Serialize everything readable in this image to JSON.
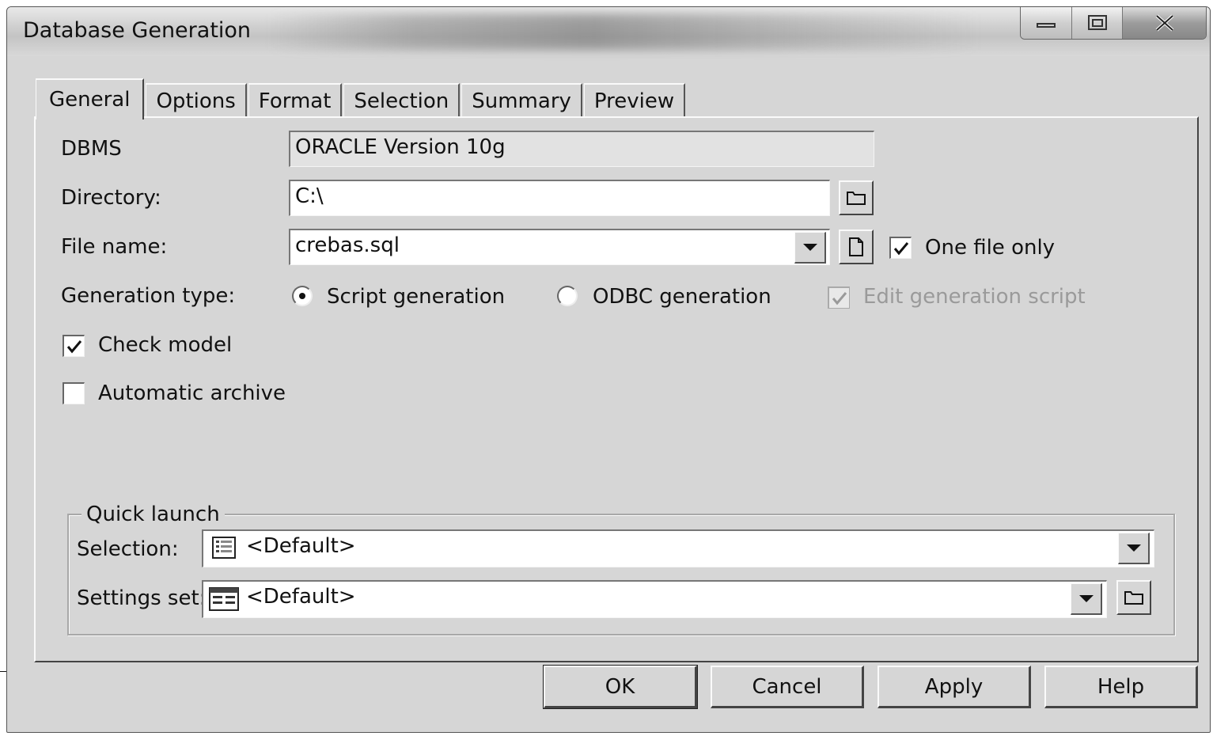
{
  "window": {
    "title": "Database Generation",
    "controls": {
      "minimize": "minimize",
      "maximize": "maximize",
      "close": "close"
    }
  },
  "tabs": [
    "General",
    "Options",
    "Format",
    "Selection",
    "Summary",
    "Preview"
  ],
  "active_tab": "General",
  "general": {
    "dbms_label": "DBMS",
    "dbms_value": "ORACLE Version 10g",
    "directory_label": "Directory:",
    "directory_value": "C:\\",
    "filename_label": "File name:",
    "filename_value": "crebas.sql",
    "one_file_only_label": "One file only",
    "one_file_only_checked": true,
    "generation_type_label": "Generation type:",
    "script_generation_label": "Script generation",
    "script_generation_selected": true,
    "odbc_generation_label": "ODBC generation",
    "odbc_generation_selected": false,
    "edit_script_label": "Edit generation script",
    "edit_script_checked": true,
    "edit_script_enabled": false,
    "check_model_label": "Check model",
    "check_model_checked": true,
    "auto_archive_label": "Automatic archive",
    "auto_archive_checked": false
  },
  "quick_launch": {
    "legend": "Quick launch",
    "selection_label": "Selection:",
    "selection_value": "<Default>",
    "settings_label": "Settings set:",
    "settings_value": "<Default>"
  },
  "buttons": {
    "ok": "OK",
    "cancel": "Cancel",
    "apply": "Apply",
    "help": "Help"
  }
}
